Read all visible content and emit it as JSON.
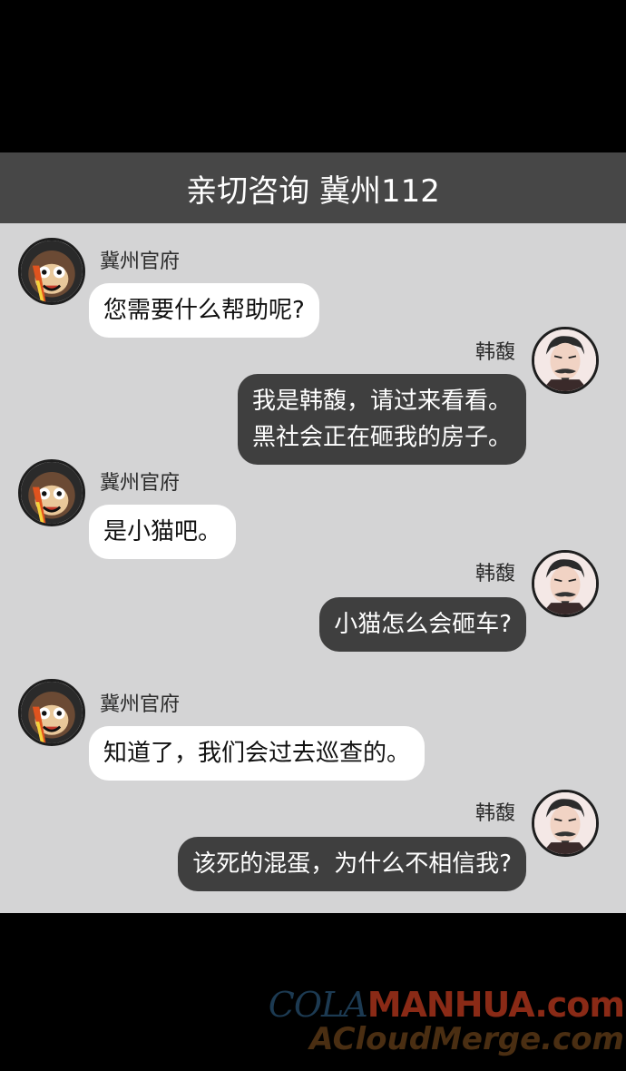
{
  "header": {
    "title": "亲切咨询 冀州112"
  },
  "messages": [
    {
      "sender": "冀州官府",
      "avatar": "monkey-avatar",
      "lines": [
        "您需要什么帮助呢?"
      ]
    },
    {
      "sender": "韩馥",
      "avatar": "man-avatar",
      "lines": [
        "我是韩馥，请过来看看。",
        "黑社会正在砸我的房子。"
      ]
    },
    {
      "sender": "冀州官府",
      "avatar": "monkey-avatar",
      "lines": [
        "是小猫吧。"
      ]
    },
    {
      "sender": "韩馥",
      "avatar": "man-avatar",
      "lines": [
        "小猫怎么会砸车?"
      ]
    },
    {
      "sender": "冀州官府",
      "avatar": "monkey-avatar",
      "lines": [
        "知道了，我们会过去巡查的。"
      ]
    },
    {
      "sender": "韩馥",
      "avatar": "man-avatar",
      "lines": [
        "该死的混蛋，为什么不相信我?"
      ]
    }
  ],
  "watermark": {
    "part1": "COLA",
    "part2": "MANHUA.com",
    "line2": "ACloudMerge.com"
  },
  "colors": {
    "panel": "#d4d4d5",
    "header": "#474747",
    "incoming_bubble": "#ffffff",
    "outgoing_bubble": "#3f3f3f"
  }
}
